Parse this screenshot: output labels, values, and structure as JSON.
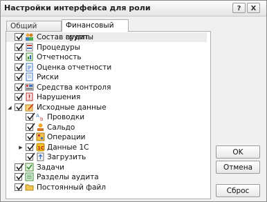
{
  "window": {
    "title": "Настройки интерфейса для роли",
    "help_glyph": "?",
    "close_glyph": "X"
  },
  "tabs": [
    {
      "label": "Общий интерфейс"
    },
    {
      "label": "Финансовый аудит"
    }
  ],
  "tree": {
    "items": [
      {
        "label": "Состав группы",
        "checked": true,
        "icon": "people-group-icon"
      },
      {
        "label": "Процедуры",
        "checked": true,
        "icon": "procedures-icon"
      },
      {
        "label": "Отчетность",
        "checked": true,
        "icon": "report-icon"
      },
      {
        "label": "Оценка отчетности",
        "checked": true,
        "icon": "report-assessment-icon"
      },
      {
        "label": "Риски",
        "checked": true,
        "icon": "risks-icon"
      },
      {
        "label": "Средства контроля",
        "checked": true,
        "icon": "controls-icon"
      },
      {
        "label": "Нарушения",
        "checked": true,
        "icon": "violations-icon"
      },
      {
        "label": "Исходные данные",
        "checked": true,
        "icon": "source-data-icon",
        "expanded": true
      },
      {
        "label": "Проводки",
        "checked": true,
        "icon": "postings-icon"
      },
      {
        "label": "Сальдо",
        "checked": true,
        "icon": "balance-icon"
      },
      {
        "label": "Операции",
        "checked": true,
        "icon": "operations-icon"
      },
      {
        "label": "Данные 1С",
        "checked": true,
        "icon": "data-1c-icon",
        "expanded": false
      },
      {
        "label": "Загрузить",
        "checked": true,
        "icon": "upload-icon"
      },
      {
        "label": "Задачи",
        "checked": true,
        "icon": "tasks-icon"
      },
      {
        "label": "Разделы аудита",
        "checked": true,
        "icon": "audit-sections-icon"
      },
      {
        "label": "Постоянный файл",
        "checked": true,
        "icon": "folder-icon"
      }
    ]
  },
  "buttons": {
    "ok": "OK",
    "cancel": "Отмена",
    "reset": "Сброс"
  }
}
